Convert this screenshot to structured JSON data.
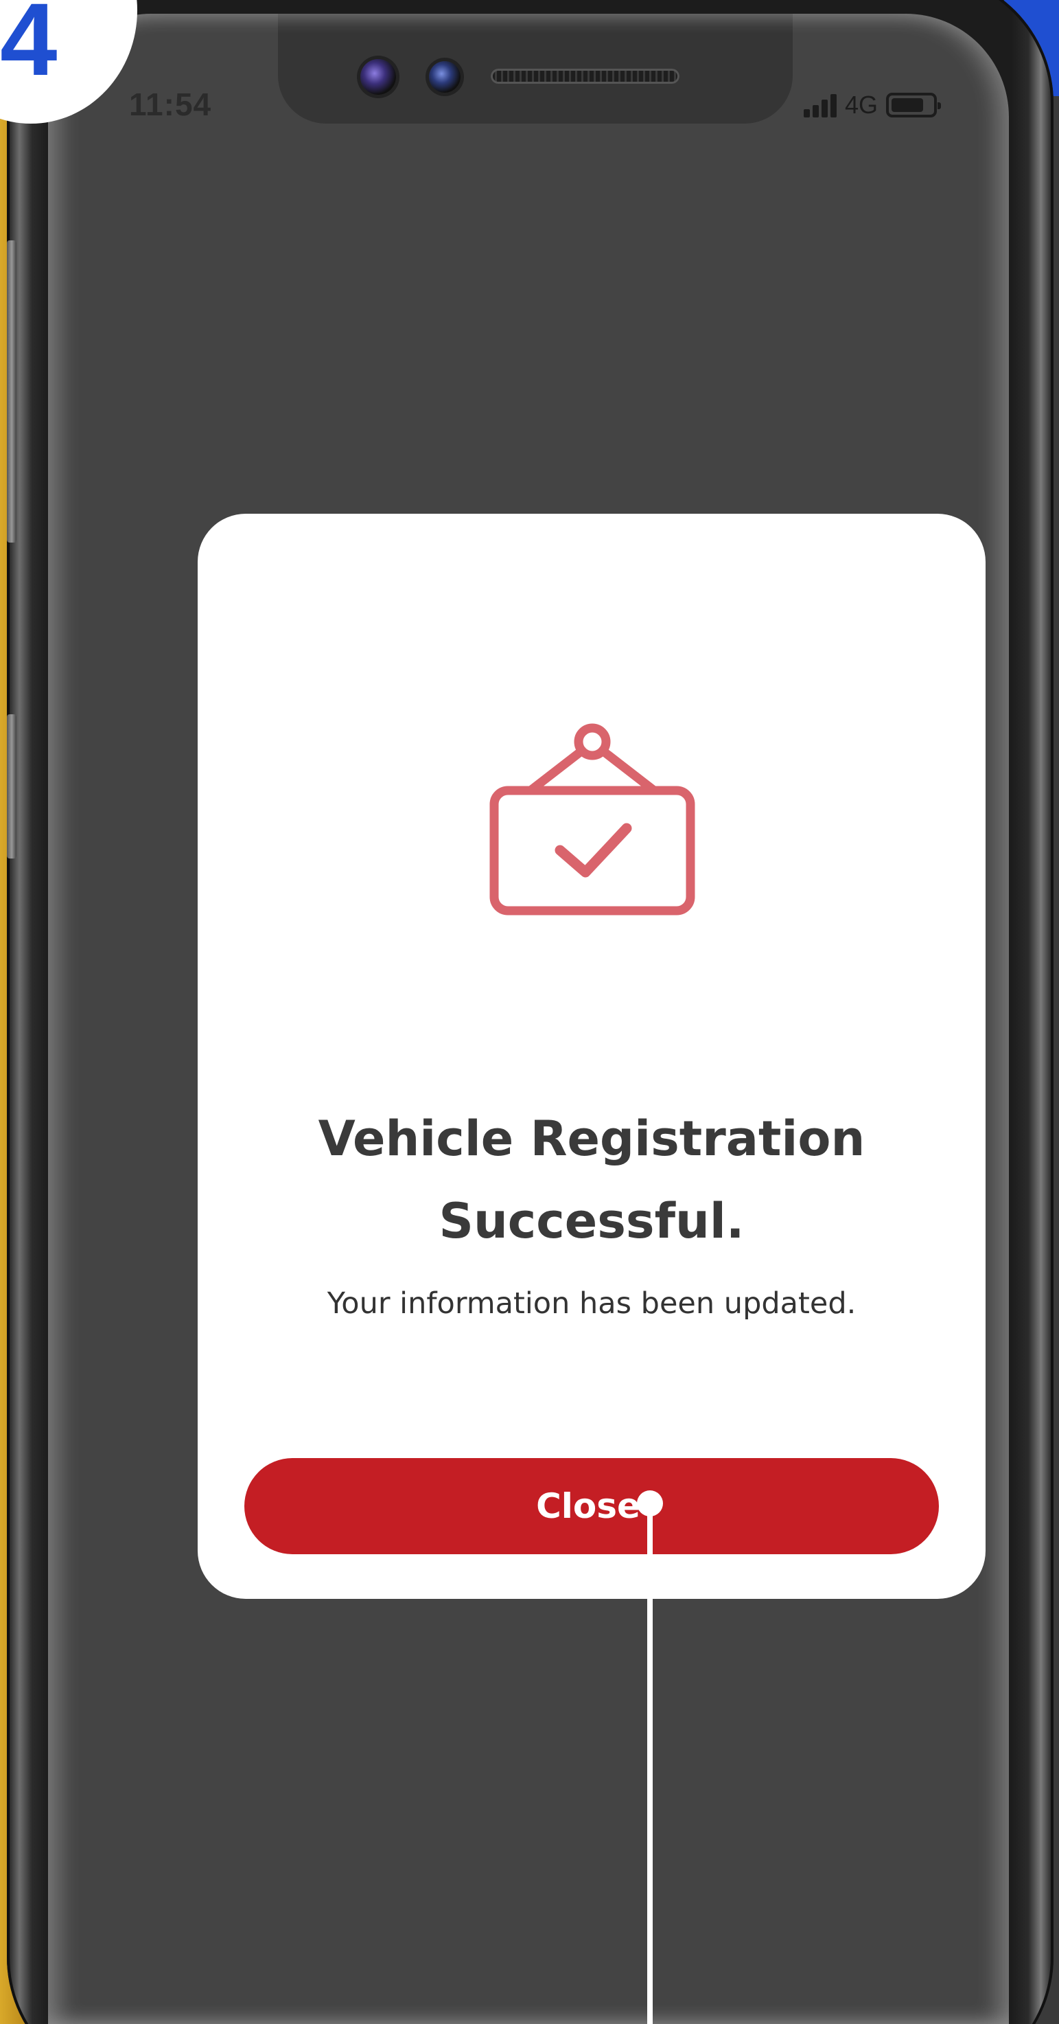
{
  "step": {
    "number": "4",
    "color": "#1f4fd1"
  },
  "status_bar": {
    "time": "11:54",
    "network": "4G",
    "icons": [
      "signal-icon",
      "battery-icon"
    ]
  },
  "dialog": {
    "icon": "hanging-sign-check-icon",
    "icon_color": "#d9646c",
    "title": "Vehicle Registration Successful.",
    "message": "Your information has been updated.",
    "close_label": "Close",
    "button_color": "#c41e24"
  },
  "colors": {
    "screen_background": "#444444",
    "dialog_background": "#ffffff"
  }
}
